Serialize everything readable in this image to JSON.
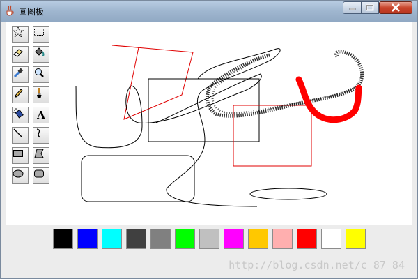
{
  "window": {
    "title": "画图板"
  },
  "tools": [
    {
      "name": "free-select-tool",
      "icon": "star-select-icon"
    },
    {
      "name": "rect-select-tool",
      "icon": "rect-select-icon"
    },
    {
      "name": "eraser-tool",
      "icon": "eraser-icon"
    },
    {
      "name": "fill-tool",
      "icon": "bucket-icon"
    },
    {
      "name": "color-picker-tool",
      "icon": "eyedropper-icon"
    },
    {
      "name": "magnifier-tool",
      "icon": "magnifier-icon"
    },
    {
      "name": "pencil-tool",
      "icon": "pencil-icon"
    },
    {
      "name": "brush-tool",
      "icon": "brush-icon"
    },
    {
      "name": "airbrush-tool",
      "icon": "spray-icon"
    },
    {
      "name": "text-tool",
      "icon": "text-icon",
      "label": "A"
    },
    {
      "name": "line-tool",
      "icon": "line-icon"
    },
    {
      "name": "curve-tool",
      "icon": "curve-icon"
    },
    {
      "name": "rectangle-tool",
      "icon": "rectangle-icon"
    },
    {
      "name": "polygon-tool",
      "icon": "polygon-icon"
    },
    {
      "name": "ellipse-tool",
      "icon": "ellipse-icon"
    },
    {
      "name": "rounded-rect-tool",
      "icon": "rounded-rect-icon"
    }
  ],
  "palette": [
    "#000000",
    "#0000ff",
    "#00ffff",
    "#404040",
    "#808080",
    "#00ff00",
    "#c0c0c0",
    "#ff00ff",
    "#ffc800",
    "#ffafaf",
    "#ff0000",
    "#ffffff",
    "#ffff00"
  ],
  "watermark": "http://blog.csdn.net/c_87_84"
}
